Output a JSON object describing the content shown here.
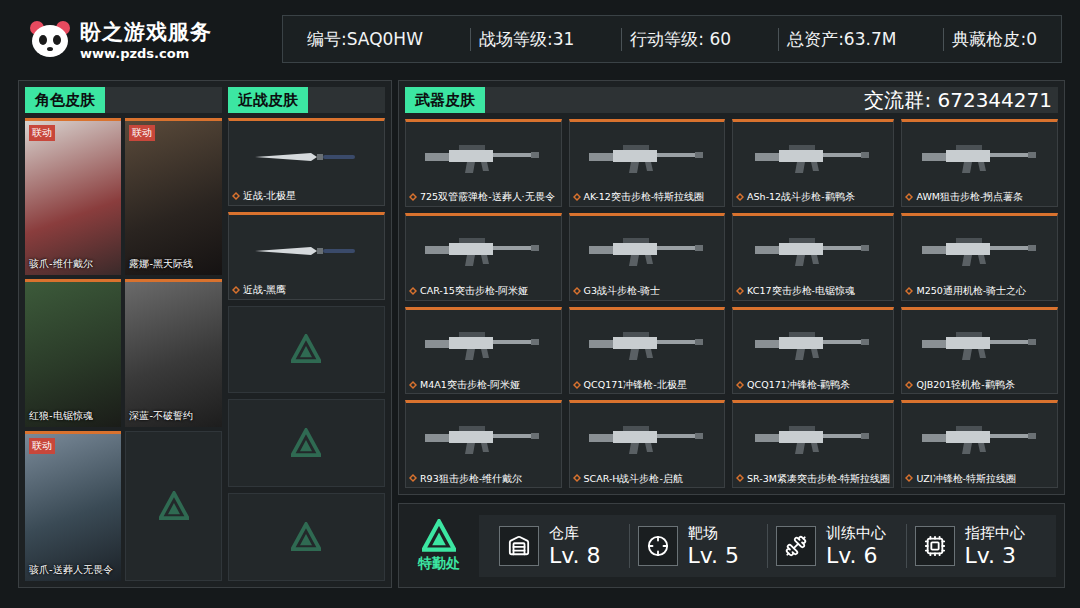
{
  "brand": {
    "name": "盼之游戏服务",
    "url": "www.pzds.com"
  },
  "stats": [
    "编号:SAQ0HW",
    "战场等级:31",
    "行动等级: 60",
    "总资产:63.7M",
    "典藏枪皮:0"
  ],
  "character_skins": {
    "title": "角色皮肤",
    "items": [
      {
        "kind": "skin",
        "name": "骇爪-维什戴尔",
        "badge": "联动"
      },
      {
        "kind": "skin",
        "name": "露娜-黑天际线",
        "badge": "联动"
      },
      {
        "kind": "skin",
        "name": "红狼-电锯惊魂"
      },
      {
        "kind": "skin",
        "name": "深蓝-不破誓约"
      },
      {
        "kind": "skin",
        "name": "骇爪-送葬人无畏令",
        "badge": "联动"
      },
      {
        "kind": "empty"
      }
    ]
  },
  "melee_skins": {
    "title": "近战皮肤",
    "items": [
      {
        "kind": "skin",
        "name": "近战-北极星"
      },
      {
        "kind": "skin",
        "name": "近战-黑鹰"
      },
      {
        "kind": "empty"
      },
      {
        "kind": "empty"
      },
      {
        "kind": "empty"
      }
    ]
  },
  "weapon_skins": {
    "title": "武器皮肤",
    "group": "交流群: 672344271",
    "items": [
      "725双管霰弹枪-送葬人·无畏令",
      "AK-12突击步枪-特斯拉线圈",
      "ASh-12战斗步枪-鹳鸭杀",
      "AWM狙击步枪-拐点薯条",
      "CAR-15突击步枪-阿米娅",
      "G3战斗步枪-骑士",
      "KC17突击步枪-电锯惊魂",
      "M250通用机枪-骑士之心",
      "M4A1突击步枪-阿米娅",
      "QCQ171冲锋枪-北极星",
      "QCQ171冲锋枪-鹳鸭杀",
      "QJB201轻机枪-鹳鸭杀",
      "R93狙击步枪-维什戴尔",
      "SCAR-H战斗步枪-启航",
      "SR-3M紧凑突击步枪-特斯拉线圈",
      "UZI冲锋枪-特斯拉线圈"
    ]
  },
  "facility": {
    "title": "特勤处",
    "items": [
      {
        "name": "仓库",
        "level": "Lv. 8"
      },
      {
        "name": "靶场",
        "level": "Lv. 5"
      },
      {
        "name": "训练中心",
        "level": "Lv. 6"
      },
      {
        "name": "指挥中心",
        "level": "Lv. 3"
      }
    ]
  }
}
